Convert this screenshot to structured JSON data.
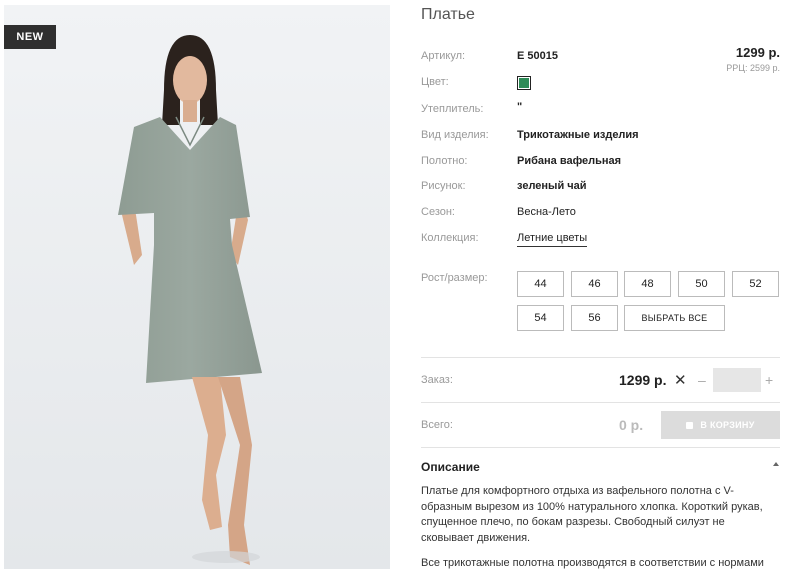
{
  "badge": "NEW",
  "product": {
    "title": "Платье",
    "price": "1299 р.",
    "rrc": "РРЦ: 2599 р."
  },
  "attributes": {
    "article_label": "Артикул:",
    "article_value": "E 50015",
    "color_label": "Цвет:",
    "color_hex": "#2e8b57",
    "insulation_label": "Утеплитель:",
    "insulation_value": "\"",
    "type_label": "Вид изделия:",
    "type_value": "Трикотажные изделия",
    "fabric_label": "Полотно:",
    "fabric_value": "Рибана вафельная",
    "pattern_label": "Рисунок:",
    "pattern_value": "зеленый чай",
    "season_label": "Сезон:",
    "season_value": "Весна-Лето",
    "collection_label": "Коллекция:",
    "collection_value": "Летние цветы"
  },
  "sizes": {
    "label": "Рост/размер:",
    "items": [
      "44",
      "46",
      "48",
      "50",
      "52",
      "54",
      "56"
    ],
    "select_all": "ВЫБРАТЬ ВСЕ"
  },
  "order": {
    "label": "Заказ:",
    "price": "1299 р.",
    "remove_icon": "close-icon",
    "minus": "–",
    "plus": "+",
    "quantity": ""
  },
  "total": {
    "label": "Всего:",
    "value": "0 р.",
    "cart_button": "В КОРЗИНУ"
  },
  "description": {
    "title": "Описание",
    "text": "Платье для комфортного отдыха из вафельного полотна с V-образным вырезом из 100% натурального хлопка. Короткий рукав, спущенное плечо, по бокам разрезы. Свободный силуэт не сковывает движения.",
    "text2": "Все трикотажные полотна производятся в соответствии с нормами"
  }
}
